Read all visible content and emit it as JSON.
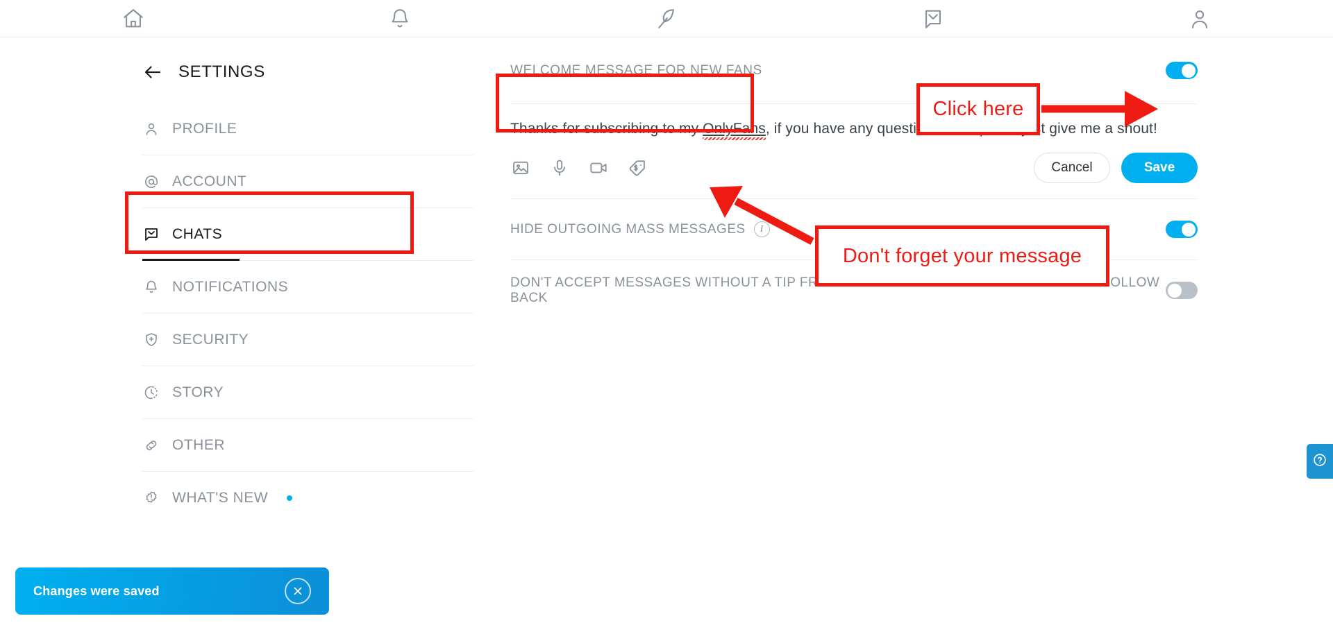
{
  "topnav": {
    "items": [
      {
        "name": "home-icon",
        "label": "Home"
      },
      {
        "name": "bell-icon",
        "label": "Notifications"
      },
      {
        "name": "quill-icon",
        "label": "New Post"
      },
      {
        "name": "envelope-icon",
        "label": "Messages"
      },
      {
        "name": "user-icon",
        "label": "Profile"
      }
    ]
  },
  "sidebar": {
    "title": "SETTINGS",
    "back_icon": "back-arrow-icon",
    "items": [
      {
        "label": "PROFILE",
        "icon": "person-icon",
        "active": false,
        "dot": false
      },
      {
        "label": "ACCOUNT",
        "icon": "at-sign-icon",
        "active": false,
        "dot": false
      },
      {
        "label": "CHATS",
        "icon": "chat-bubble-icon",
        "active": true,
        "dot": false
      },
      {
        "label": "NOTIFICATIONS",
        "icon": "bell-icon",
        "active": false,
        "dot": false
      },
      {
        "label": "SECURITY",
        "icon": "shield-plus-icon",
        "active": false,
        "dot": false
      },
      {
        "label": "STORY",
        "icon": "clock-icon",
        "active": false,
        "dot": false
      },
      {
        "label": "OTHER",
        "icon": "link-icon",
        "active": false,
        "dot": false
      },
      {
        "label": "WHAT'S NEW",
        "icon": "alert-badge-icon",
        "active": false,
        "dot": true
      }
    ]
  },
  "main": {
    "welcome": {
      "label": "WELCOME MESSAGE FOR NEW FANS",
      "toggle_on": true,
      "message_prefix": "Thanks for subscribing to my ",
      "message_spellword": "OnlyFans",
      "message_suffix": ", if you have any questions or requests just give me a shout!",
      "tools": [
        {
          "name": "image-icon",
          "label": "Add photo"
        },
        {
          "name": "microphone-icon",
          "label": "Record audio"
        },
        {
          "name": "video-camera-icon",
          "label": "Record video"
        },
        {
          "name": "price-tag-icon",
          "label": "Set price"
        }
      ],
      "cancel_label": "Cancel",
      "save_label": "Save"
    },
    "rows": [
      {
        "label": "HIDE OUTGOING MASS MESSAGES",
        "has_info": true,
        "info_icon": "info-icon",
        "toggle_on": true
      },
      {
        "label": "DON'T ACCEPT MESSAGES WITHOUT A TIP FROM FREE FOLLOWERS WHOM YOU DON'T FOLLOW BACK",
        "has_info": false,
        "info_icon": "",
        "toggle_on": false
      }
    ]
  },
  "toast": {
    "text": "Changes were saved",
    "close_icon": "close-icon"
  },
  "help": {
    "icon": "question-mark-icon"
  },
  "annotations": {
    "click_here": "Click here",
    "dont_forget": "Don't forget your message"
  },
  "colors": {
    "accent": "#00aff0",
    "annotation_red": "#ee1b13",
    "muted_text": "#8a919a",
    "dark_text": "#1a1a1a"
  }
}
